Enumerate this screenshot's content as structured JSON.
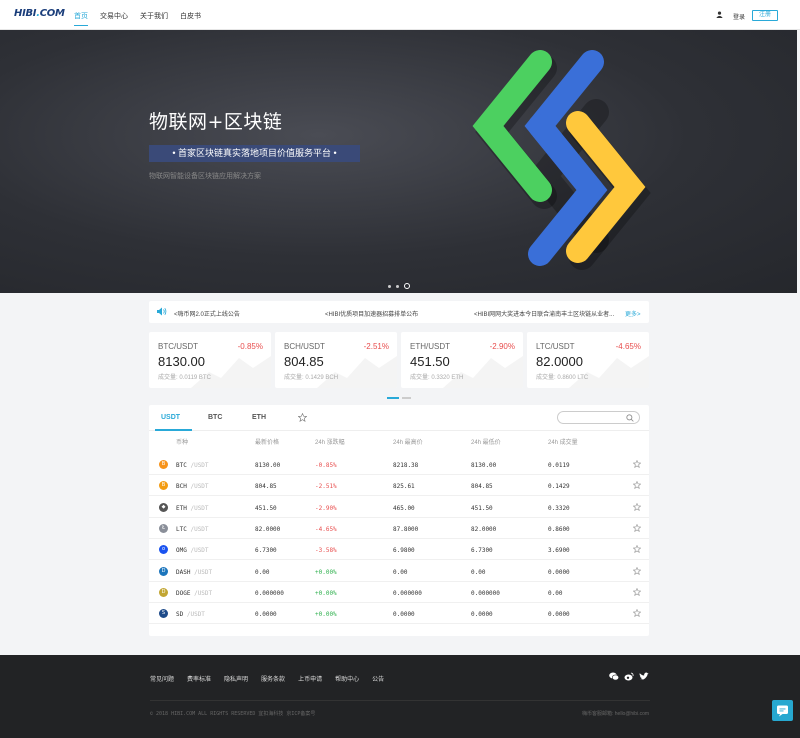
{
  "header": {
    "logo": "HIBI.COM",
    "nav": [
      "首页",
      "交易中心",
      "关于我们",
      "白皮书"
    ],
    "login": "登录",
    "register": "注册"
  },
  "banner": {
    "title": "物联网+区块链",
    "tag": "•  首家区块链真实落地项目价值服务平台  •",
    "subtitle": "物联网智能设备区块链应用解决方案"
  },
  "notices": {
    "n1": "<嗨币网2.0正式上线公告",
    "n2": "<HIBI优质项目加速器招募排单公布",
    "n3": "<HIBI网网大奖进本今日联合渝南丰土区块链从业者...",
    "more": "更多>"
  },
  "tickers": [
    {
      "pair": "BTC/USDT",
      "change": "-0.85%",
      "price": "8130.00",
      "volume": "成交量: 0.0119 BTC"
    },
    {
      "pair": "BCH/USDT",
      "change": "-2.51%",
      "price": "804.85",
      "volume": "成交量: 0.1429 BCH"
    },
    {
      "pair": "ETH/USDT",
      "change": "-2.90%",
      "price": "451.50",
      "volume": "成交量: 0.3320 ETH"
    },
    {
      "pair": "LTC/USDT",
      "change": "-4.65%",
      "price": "82.0000",
      "volume": "成交量: 0.8600 LTC"
    }
  ],
  "market": {
    "tabs": [
      "USDT",
      "BTC",
      "ETH"
    ],
    "columns": [
      "币种",
      "最新价格",
      "24h 涨跌幅",
      "24h 最高价",
      "24h 最低价",
      "24h 成交量"
    ],
    "rows": [
      {
        "coin": "BTC",
        "quote": "/USDT",
        "price": "8130.00",
        "change": "-0.85%",
        "high": "8218.38",
        "low": "8130.00",
        "volume": "0.0119",
        "color": "#f7931a",
        "glyph": "B"
      },
      {
        "coin": "BCH",
        "quote": "/USDT",
        "price": "804.85",
        "change": "-2.51%",
        "high": "825.61",
        "low": "804.85",
        "volume": "0.1429",
        "color": "#f39c12",
        "glyph": "B"
      },
      {
        "coin": "ETH",
        "quote": "/USDT",
        "price": "451.50",
        "change": "-2.90%",
        "high": "465.00",
        "low": "451.50",
        "volume": "0.3320",
        "color": "#555555",
        "glyph": "◆"
      },
      {
        "coin": "LTC",
        "quote": "/USDT",
        "price": "82.0000",
        "change": "-4.65%",
        "high": "87.8000",
        "low": "82.0000",
        "volume": "0.8600",
        "color": "#8a8f99",
        "glyph": "Ł"
      },
      {
        "coin": "OMG",
        "quote": "/USDT",
        "price": "6.7300",
        "change": "-3.58%",
        "high": "6.9800",
        "low": "6.7300",
        "volume": "3.6900",
        "color": "#1a53f0",
        "glyph": "o"
      },
      {
        "coin": "DASH",
        "quote": "/USDT",
        "price": "0.00",
        "change": "+0.00%",
        "high": "0.00",
        "low": "0.00",
        "volume": "0.0000",
        "color": "#1c75bc",
        "glyph": "D"
      },
      {
        "coin": "DOGE",
        "quote": "/USDT",
        "price": "0.000000",
        "change": "+0.00%",
        "high": "0.000000",
        "low": "0.000000",
        "volume": "0.00",
        "color": "#c2a633",
        "glyph": "D"
      },
      {
        "coin": "SD",
        "quote": "/USDT",
        "price": "0.0000",
        "change": "+0.00%",
        "high": "0.0000",
        "low": "0.0000",
        "volume": "0.0000",
        "color": "#1e4b8a",
        "glyph": "S"
      }
    ]
  },
  "footer": {
    "links": [
      "常见问题",
      "费率标准",
      "隐私声明",
      "服务条款",
      "上币申请",
      "帮助中心",
      "公告"
    ],
    "copyright": "© 2018 HIBI.COM ALL RIGHTS RESERVED 宜扣海科技 京ICP备案号",
    "mail": "嗨币客服邮箱: hello@hibi.com"
  },
  "colors": {
    "accent": "#29a9d8",
    "down": "#e84e4e",
    "up": "#2fb04e"
  }
}
